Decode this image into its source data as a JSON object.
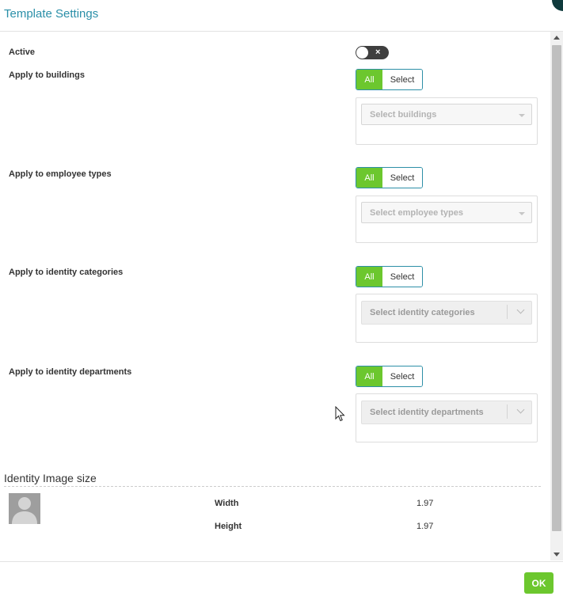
{
  "dialog": {
    "title": "Template Settings",
    "ok_label": "OK"
  },
  "settings": {
    "active_label": "Active",
    "active_state": "off",
    "toggle_glyph": "×",
    "groups": [
      {
        "label": "Apply to buildings",
        "all_label": "All",
        "select_label": "Select",
        "placeholder": "Select buildings"
      },
      {
        "label": "Apply to employee types",
        "all_label": "All",
        "select_label": "Select",
        "placeholder": "Select employee types"
      },
      {
        "label": "Apply to identity categories",
        "all_label": "All",
        "select_label": "Select",
        "placeholder": "Select identity categories"
      },
      {
        "label": "Apply to identity departments",
        "all_label": "All",
        "select_label": "Select",
        "placeholder": "Select identity departments"
      }
    ]
  },
  "image_size": {
    "section_title": "Identity Image size",
    "width_label": "Width",
    "width_value": "1.97",
    "height_label": "Height",
    "height_value": "1.97"
  },
  "colors": {
    "accent_green": "#6cc72e",
    "title_blue": "#2a8fa8",
    "toggle_off": "#3f3f3f"
  },
  "icons": {
    "avatar": "person-placeholder-icon",
    "cursor": "mouse-pointer-icon"
  }
}
